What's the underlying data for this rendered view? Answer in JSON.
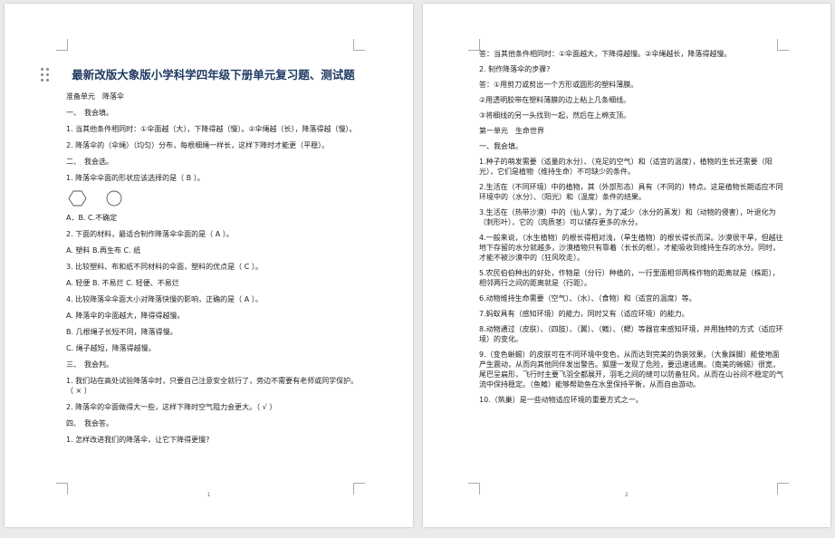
{
  "page1": {
    "title": "最新改版大象版小学科学四年级下册单元复习题、测试题",
    "page_number": "1",
    "paragraphs": [
      "准备单元　降落伞",
      "一、　我会填。",
      "1. 当其他条件相同时：①伞面越（大），下降得越（慢）。②伞绳越（长），降落得越（慢）。",
      "2. 降落伞的（伞绳）（均匀）分布，每根细绳一样长，这样下降时才能更（平稳）。",
      "二、　我会选。",
      "1. 降落伞伞面的形状应该选择的是（ B ）。",
      "A．B. C.不确定",
      "2. 下面的材料，最适合制作降落伞伞面的是（ A ）。",
      "A. 塑料 B.再生布 C. 纸",
      "3. 比较塑料、布和纸不同材料的伞面，塑料的优点是（ C ）。",
      "A. 轻便 B. 不易烂 C. 轻便、不易烂",
      "4. 比较降落伞伞面大小对降落快慢的影响，正确的是（ A ）。",
      "A. 降落伞的伞面越大，降得得越慢。",
      "B. 几根绳子长短不同，降落得慢。",
      "C. 绳子越短，降落得越慢。",
      "三、　我会判。",
      "1. 我们站在高处试验降落伞时，只要自己注意安全就行了，旁边不需要有老师或同学保护。（ × ）",
      "2. 降落伞的伞面做得大一些，这样下降时空气阻力会更大。（ √ ）",
      "四、　我会答。",
      "1. 怎样改进我们的降落伞，让它下降得更慢?"
    ]
  },
  "page2": {
    "page_number": "2",
    "paragraphs": [
      "答：当其他条件相同时：①伞面越大，下降得越慢。②伞绳越长，降落得越慢。",
      "2. 制作降落伞的步骤?",
      "答：①用剪刀或剪出一个方形或圆形的塑料薄膜。",
      "②用透明胶带在塑料薄膜的边上粘上几条细线。",
      "③将细线的另一头找到一起，然后在上棉支顶。",
      "第一单元　生命世界",
      "一、我会填。",
      "1.种子的萌发需要（适量的水分）、（充足的空气）和（适宜的温度），植物的生长还需要（阳光），它们是植物（维持生命）不可缺少的条件。",
      "2.生活在（不同环境）中的植物，其（外部形态）具有（不同的）特点。这是植物长期适应不同环境中的（水分）、（阳光）和（温度）条件的结果。",
      "3.生活在（热带沙漠）中的（仙人掌），为了减少（水分的蒸发）和（动物的侵害），叶退化为（刺形叶），它的（肉质茎）可以储存更多的水分。",
      "4.一般来说，（水生植物）的根长得相对浅，（旱生植物）的根长得长而深。沙漠很干旱，但越往地下存留的水分就越多，沙漠植物只有靠着（长长的根），才能吸收到维持生存的水分。同时，才能不被沙漠中的（狂风吹走）。",
      "5.农民伯伯种出的好处，作物是（分行）种植的，一行里面相邻两株作物的距离就是（株距），相邻两行之间的距离就是（行距）。",
      "6.动物维持生命需要（空气）、（水）、（食物）和（适宜的温度）等。",
      "7.蚂蚁具有（感知环境）的能力，同时又有（适应环境）的能力。",
      "8.动物通过（皮肤）、（四肢）、（翼）、（鳍）、（鳃）等器官来感知环境，并用独特的方式（适应环境）的变化。",
      "9.（变色蜥蜴）的皮肤可在不同环境中变色，从而达到完美的伪装效果。（大象踩脚）能使地面产生震动，从而向其他同伴发出警告。狐狸一发现了危险，要迅速逃离。（南美的蜥蜴）很宽，尾巴呈扁形，飞行时主要飞羽全都展开，羽毛之间的缝可以防备狂风，从而在山谷间不稳定的气流中保持稳定。（鱼鳍）能够帮助鱼在水里保持平衡，从而自由游动。",
      "10.（筑巢）是一些动物适应环境的重要方式之一。"
    ]
  }
}
